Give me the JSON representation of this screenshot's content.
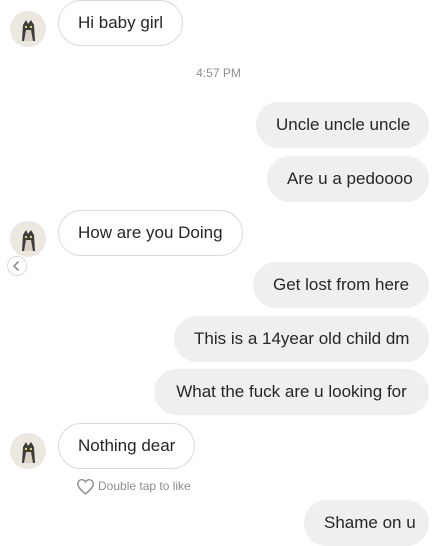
{
  "thread": {
    "timestamp": "4:57 PM",
    "like_hint": "Double tap to like",
    "messages": [
      {
        "side": "incoming",
        "text": "Hi baby girl"
      },
      {
        "side": "outgoing",
        "text": "Uncle uncle uncle"
      },
      {
        "side": "outgoing",
        "text": "Are u a pedoooo"
      },
      {
        "side": "incoming",
        "text": "How are you Doing"
      },
      {
        "side": "outgoing",
        "text": "Get lost from here"
      },
      {
        "side": "outgoing",
        "text": "This is a 14year old child dm"
      },
      {
        "side": "outgoing",
        "text": "What the fuck are u looking for"
      },
      {
        "side": "incoming",
        "text": "Nothing dear"
      },
      {
        "side": "outgoing",
        "text": "Shame on u"
      }
    ]
  },
  "colors": {
    "incoming_border": "#dbdbdb",
    "outgoing_background": "#efefef",
    "meta_text": "#8e8e8e",
    "text": "#262626"
  },
  "icons": {
    "avatar": "cat-avatar-icon",
    "reply": "reply-arrow-icon",
    "like": "heart-outline-icon"
  }
}
